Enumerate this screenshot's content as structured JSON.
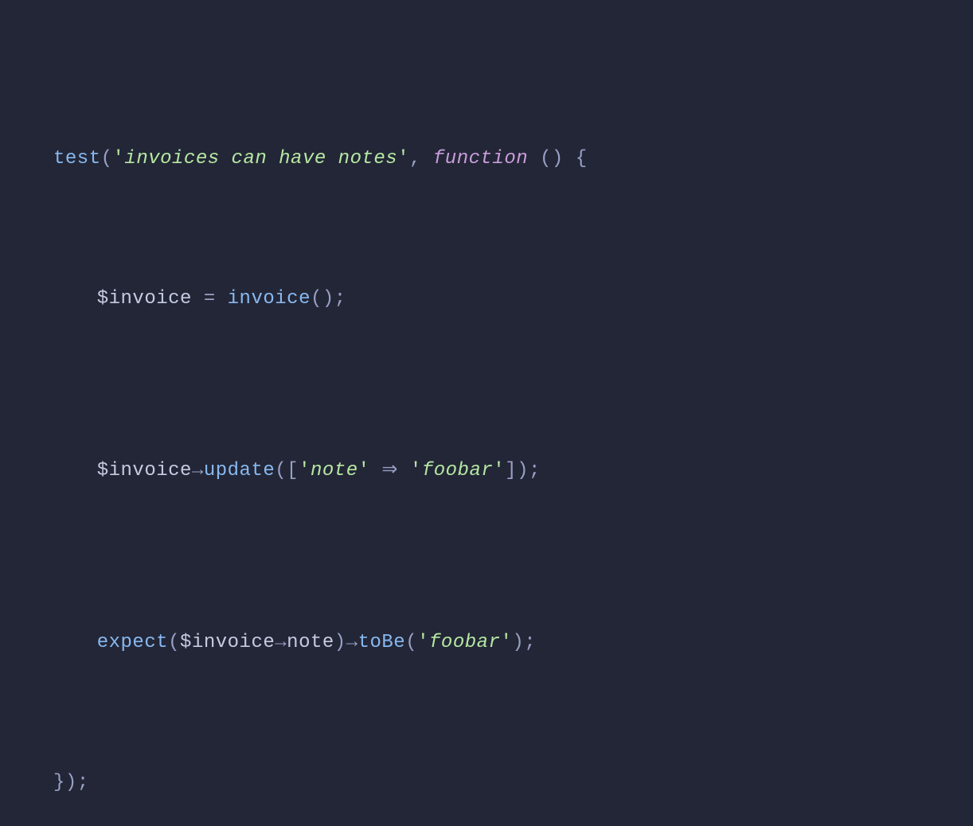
{
  "code": {
    "line1": {
      "func": "test",
      "paren_open": "(",
      "quote1": "'",
      "string": "invoices can have notes",
      "quote2": "'",
      "comma": ", ",
      "keyword": "function",
      "space": " ",
      "paren_pair": "()",
      "space2": " ",
      "brace": "{"
    },
    "line2": {
      "var": "$invoice",
      "space": " ",
      "equals": "=",
      "space2": " ",
      "func": "invoice",
      "parens": "()",
      "semi": ";"
    },
    "line3": {
      "var": "$invoice",
      "arrow": "→",
      "method": "update",
      "paren_open": "(",
      "bracket_open": "[",
      "quote1": "'",
      "key": "note",
      "quote2": "'",
      "space": " ",
      "double_arrow": "⇒",
      "space2": " ",
      "quote3": "'",
      "val": "foobar",
      "quote4": "'",
      "bracket_close": "]",
      "paren_close": ")",
      "semi": ";"
    },
    "line4": {
      "func": "expect",
      "paren_open": "(",
      "var": "$invoice",
      "arrow1": "→",
      "prop": "note",
      "paren_close": ")",
      "arrow2": "→",
      "method": "toBe",
      "paren_open2": "(",
      "quote1": "'",
      "val": "foobar",
      "quote2": "'",
      "paren_close2": ")",
      "semi": ";"
    },
    "line5": {
      "brace": "}",
      "paren": ")",
      "semi": ";"
    }
  }
}
